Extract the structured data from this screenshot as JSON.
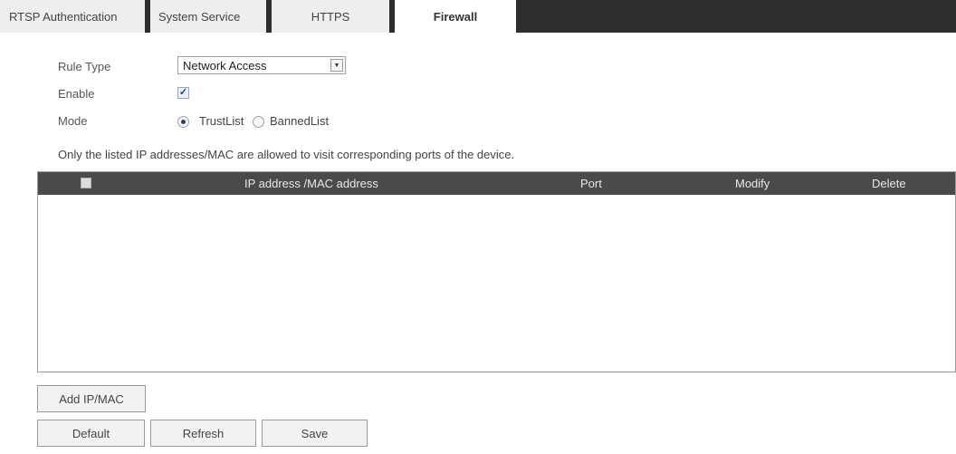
{
  "tabs": [
    {
      "label": "RTSP Authentication",
      "active": false
    },
    {
      "label": "System Service",
      "active": false
    },
    {
      "label": "HTTPS",
      "active": false
    },
    {
      "label": "Firewall",
      "active": true
    }
  ],
  "form": {
    "rule_type": {
      "label": "Rule Type",
      "value": "Network Access"
    },
    "enable": {
      "label": "Enable",
      "checked": true
    },
    "mode": {
      "label": "Mode",
      "options": [
        {
          "label": "TrustList",
          "selected": true
        },
        {
          "label": "BannedList",
          "selected": false
        }
      ]
    }
  },
  "notice": "Only the listed IP addresses/MAC are allowed to visit corresponding ports of the device.",
  "table": {
    "columns": [
      "IP address /MAC address",
      "Port",
      "Modify",
      "Delete"
    ],
    "rows": []
  },
  "buttons": {
    "add": "Add IP/MAC",
    "default": "Default",
    "refresh": "Refresh",
    "save": "Save"
  },
  "icons": {
    "select_arrow": "chevron-down-icon",
    "checkbox_check": "checkmark-icon"
  },
  "colors": {
    "tabbar_bg": "#2e2e2e",
    "table_header_bg": "#4a4a4a",
    "button_bg": "#f2f2f2"
  }
}
